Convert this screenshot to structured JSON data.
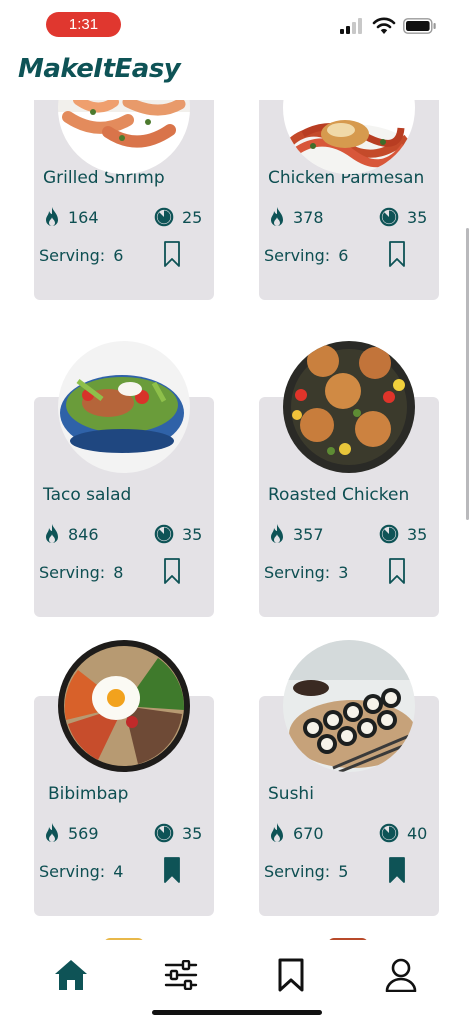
{
  "status_bar": {
    "time": "1:31"
  },
  "app": {
    "title": "MakeItEasy"
  },
  "labels": {
    "serving": "Serving:"
  },
  "colors": {
    "accent": "#0e5356",
    "card": "#e4e2e6",
    "time_pill": "#e0372f"
  },
  "recipes": [
    {
      "name": "Grilled Shrimp",
      "calories": "164",
      "time": "25",
      "serving": "6",
      "saved": false
    },
    {
      "name": "Chicken Parmesan",
      "calories": "378",
      "time": "35",
      "serving": "6",
      "saved": false
    },
    {
      "name": "Taco salad",
      "calories": "846",
      "time": "35",
      "serving": "8",
      "saved": false
    },
    {
      "name": "Roasted Chicken",
      "calories": "357",
      "time": "35",
      "serving": "3",
      "saved": false
    },
    {
      "name": "Bibimbap",
      "calories": "569",
      "time": "35",
      "serving": "4",
      "saved": true
    },
    {
      "name": "Sushi",
      "calories": "670",
      "time": "40",
      "serving": "5",
      "saved": true
    }
  ],
  "nav": [
    {
      "icon": "home-icon",
      "active": true
    },
    {
      "icon": "filter-icon",
      "active": false
    },
    {
      "icon": "bookmark-icon",
      "active": false
    },
    {
      "icon": "profile-icon",
      "active": false
    }
  ]
}
